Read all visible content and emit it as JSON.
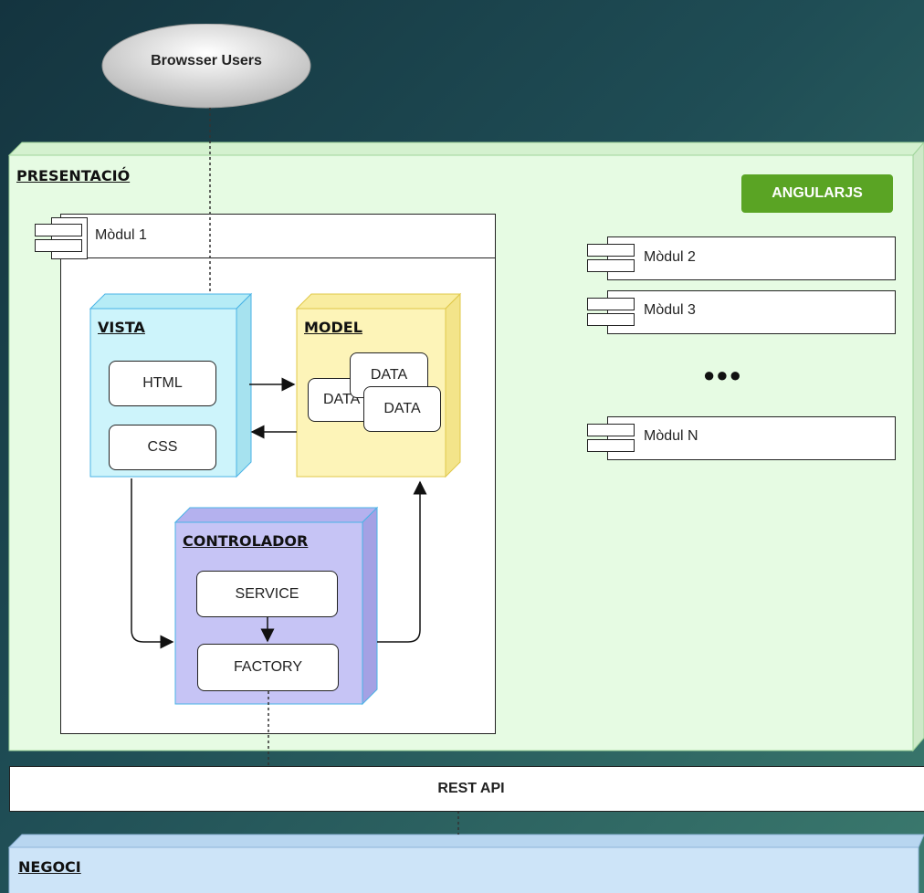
{
  "users": {
    "label": "Browsser Users"
  },
  "presentation": {
    "title": "PRESENTACIÓ",
    "badge": "ANGULARJS"
  },
  "module1": {
    "title": "Mòdul 1",
    "vista": {
      "title": "VISTA",
      "items": [
        "HTML",
        "CSS"
      ]
    },
    "model": {
      "title": "MODEL",
      "items": [
        "DATA",
        "DATA",
        "DATA"
      ]
    },
    "controlador": {
      "title": "CONTROLADOR",
      "items": [
        "SERVICE",
        "FACTORY"
      ]
    }
  },
  "modules": [
    "Mòdul 2",
    "Mòdul 3",
    "Mòdul N"
  ],
  "ellipsis": "●●●",
  "rest_api": "REST API",
  "negoci": {
    "title": "NEGOCI"
  },
  "colors": {
    "presentation": "#e6fbe3",
    "vista": "#cdf4fb",
    "model": "#fdf4b8",
    "controlador": "#c6c4f5",
    "negoci": "#cde4f8",
    "badge": "#5aa424"
  }
}
